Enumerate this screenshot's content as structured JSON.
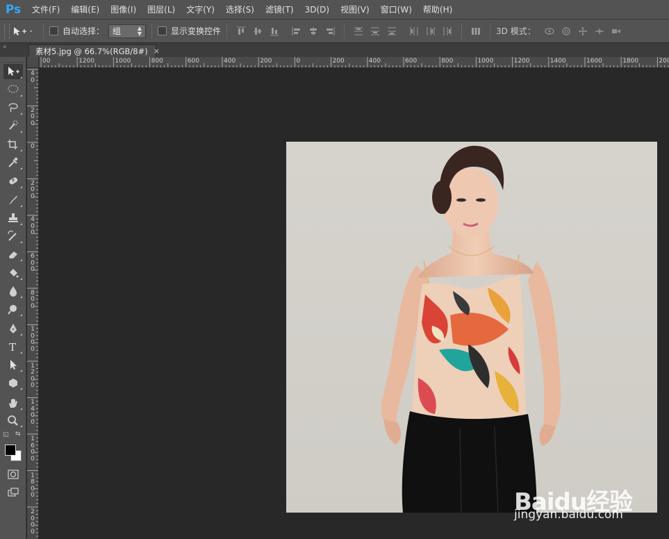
{
  "app": {
    "logo": "Ps",
    "accent": "#31a8ff"
  },
  "menu": [
    "文件(F)",
    "编辑(E)",
    "图像(I)",
    "图层(L)",
    "文字(Y)",
    "选择(S)",
    "滤镜(T)",
    "3D(D)",
    "视图(V)",
    "窗口(W)",
    "帮助(H)"
  ],
  "options": {
    "auto_select_label": "自动选择：",
    "auto_select_checked": false,
    "auto_select_value": "组",
    "show_transform_label": "显示变换控件",
    "show_transform_checked": false,
    "mode_3d_label": "3D 模式："
  },
  "document_tab": {
    "title": "素材5.jpg @ 66.7%(RGB/8#)",
    "close": "×"
  },
  "ruler": {
    "h_labels": [
      "00",
      "1200",
      "1000",
      "800",
      "600",
      "400",
      "200",
      "0",
      "200",
      "400",
      "600",
      "800",
      "1000",
      "1200",
      "1400",
      "1600",
      "1800",
      "2000"
    ],
    "v_labels": [
      "4",
      "0",
      "2",
      "0",
      "0",
      "0",
      "2",
      "0",
      "0",
      "4",
      "0",
      "0",
      "6",
      "0",
      "0",
      "8",
      "0",
      "0",
      "1",
      "0",
      "0",
      "0",
      "1",
      "2",
      "0",
      "0",
      "1",
      "4",
      "0",
      "0",
      "1",
      "6",
      "0",
      "0",
      "1",
      "8",
      "0",
      "0",
      "2",
      "0",
      "0",
      "0"
    ]
  },
  "tools": [
    "move-tool",
    "marquee-tool",
    "lasso-tool",
    "quick-selection-tool",
    "crop-tool",
    "eyedropper-tool",
    "healing-brush-tool",
    "brush-tool",
    "clone-stamp-tool",
    "history-brush-tool",
    "eraser-tool",
    "paint-bucket-tool",
    "blur-tool",
    "dodge-tool",
    "pen-tool",
    "type-tool",
    "path-selection-tool",
    "shape-tool",
    "hand-tool",
    "zoom-tool"
  ],
  "colors": {
    "foreground": "#000000",
    "background": "#ffffff"
  },
  "watermark": {
    "main": "Baidu经验",
    "sub": "jingyan.baidu.com"
  }
}
